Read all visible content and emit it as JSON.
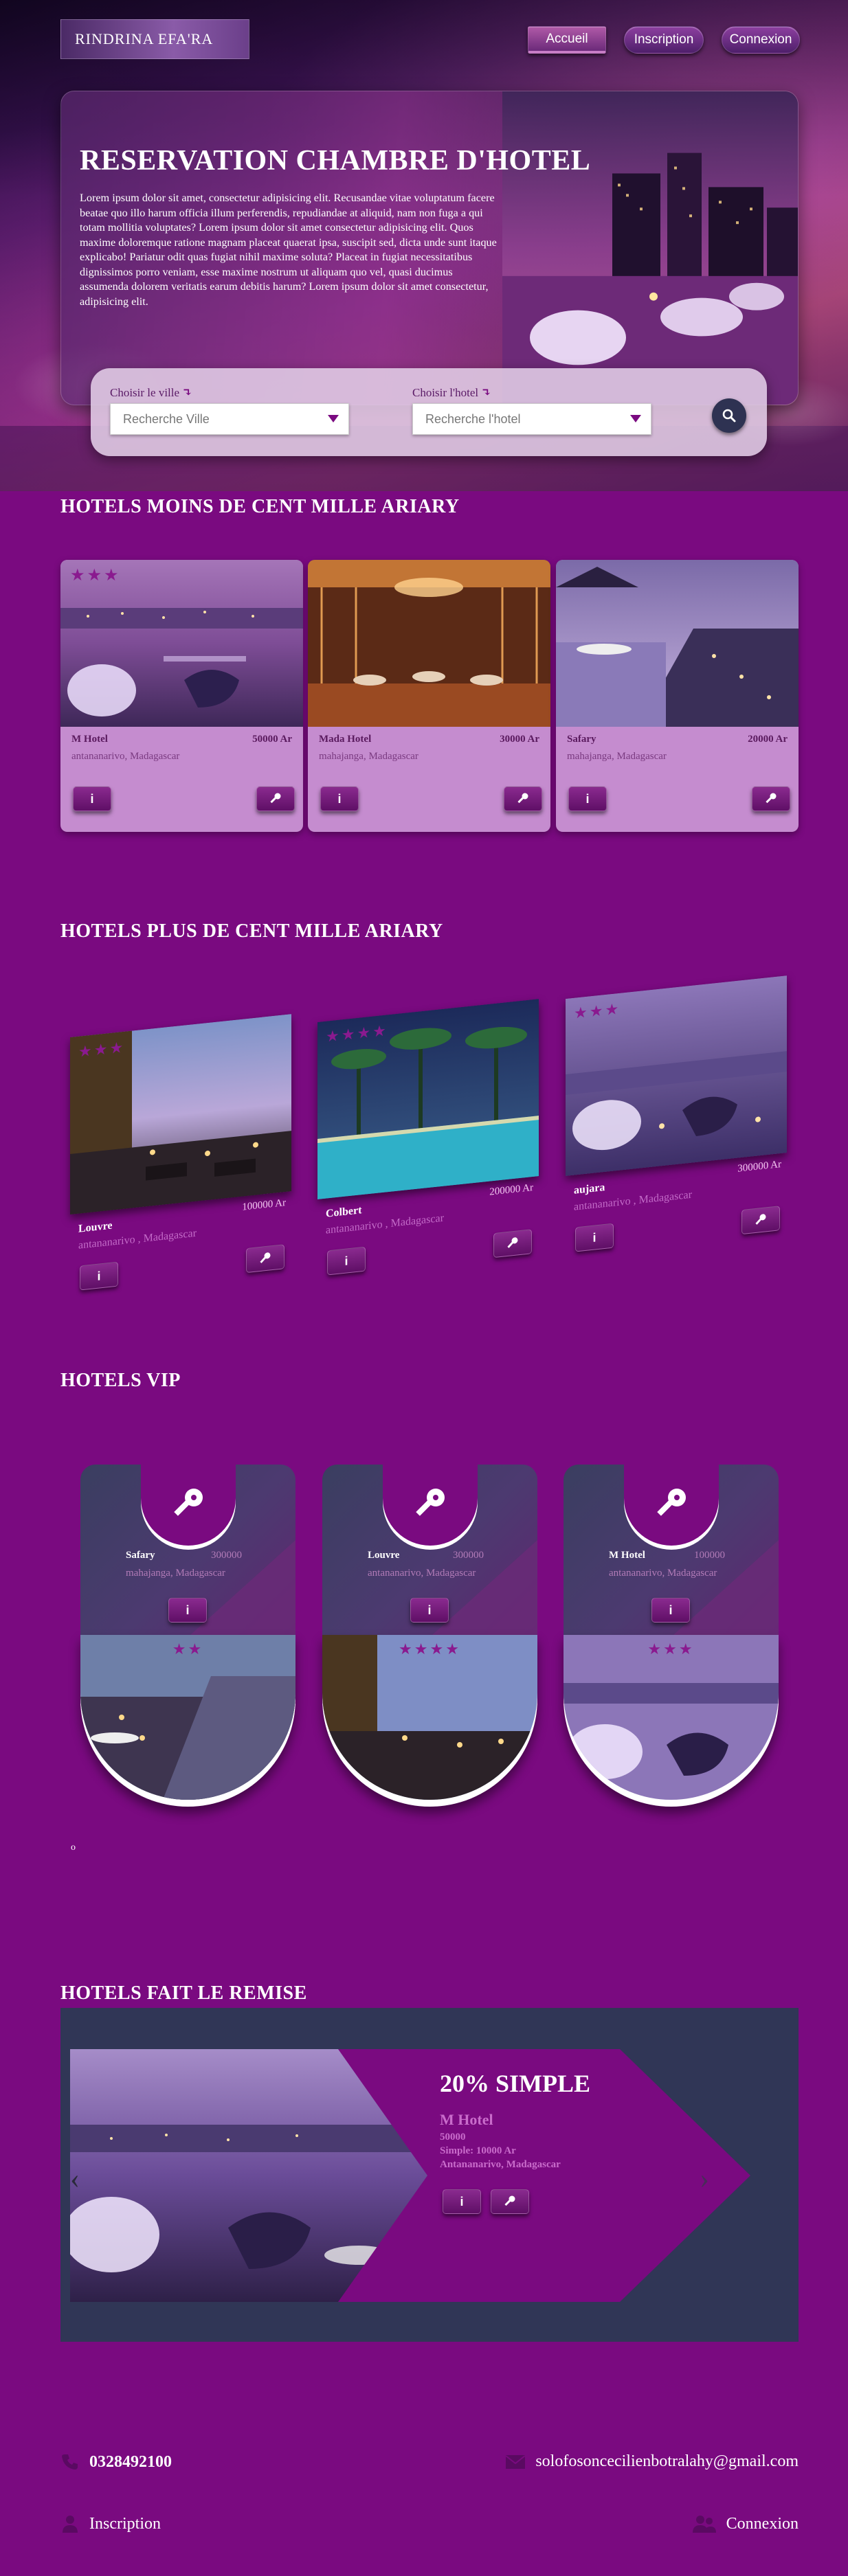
{
  "header": {
    "logo": "RINDRINA EFA'RA",
    "nav": {
      "accueil": "Accueil",
      "inscription": "Inscription",
      "connexion": "Connexion"
    }
  },
  "hero": {
    "title": "RESERVATION CHAMBRE D'HOTEL",
    "text": "Lorem ipsum dolor sit amet, consectetur adipisicing elit. Recusandae vitae voluptatum facere beatae quo illo harum officia illum perferendis, repudiandae at aliquid, nam non fuga a qui totam mollitia voluptates? Lorem ipsum dolor sit amet consectetur adipisicing elit. Quos maxime doloremque ratione magnam placeat quaerat ipsa, suscipit sed, dicta unde sunt itaque explicabo! Pariatur odit quas fugiat nihil maxime soluta? Placeat in fugiat necessitatibus dignissimos porro veniam, esse maxime nostrum ut aliquam quo vel, quasi ducimus assumenda dolorem veritatis earum debitis harum? Lorem ipsum dolor sit amet consectetur, adipisicing elit."
  },
  "search": {
    "city_label": "Choisir le ville",
    "city_placeholder": "Recherche Ville",
    "hotel_label": "Choisir l'hotel",
    "hotel_placeholder": "Recherche l'hotel",
    "label_arrow": "↴"
  },
  "section1": {
    "title": "HOTELS MOINS DE CENT MILLE ARIARY",
    "cards": [
      {
        "stars": "★★★",
        "name": "M Hotel",
        "price": "50000 Ar",
        "location": "antananarivo, Madagascar"
      },
      {
        "stars": "",
        "name": "Mada Hotel",
        "price": "30000 Ar",
        "location": "mahajanga, Madagascar"
      },
      {
        "stars": "",
        "name": "Safary",
        "price": "20000 Ar",
        "location": "mahajanga, Madagascar"
      }
    ]
  },
  "section2": {
    "title": "HOTELS PLUS DE CENT MILLE ARIARY",
    "cards": [
      {
        "stars": "★★★",
        "name": "Louvre",
        "price": "100000 Ar",
        "location": "antananarivo , Madagascar"
      },
      {
        "stars": "★★★★",
        "name": "Colbert",
        "price": "200000 Ar",
        "location": "antananarivo , Madagascar"
      },
      {
        "stars": "★★★",
        "name": "aujara",
        "price": "300000 Ar",
        "location": "antananarivo , Madagascar"
      }
    ]
  },
  "section3": {
    "title": "HOTELS VIP",
    "cards": [
      {
        "stars": "★★",
        "name": "Safary",
        "price": "300000",
        "location": "mahajanga, Madagascar"
      },
      {
        "stars": "★★★★",
        "name": "Louvre",
        "price": "300000",
        "location": "antananarivo, Madagascar"
      },
      {
        "stars": "★★★",
        "name": "M Hotel",
        "price": "100000",
        "location": "antananarivo, Madagascar"
      }
    ],
    "footnote": "o"
  },
  "section4": {
    "title": "HOTELS FAIT LE REMISE",
    "offer": {
      "headline": "20% SIMPLE",
      "name": "M Hotel",
      "price": "50000",
      "simple": "Simple: 10000 Ar",
      "location": "Antananarivo, Madagascar"
    },
    "prev": "‹",
    "next": "›"
  },
  "buttons": {
    "info": "i"
  },
  "footer": {
    "phone": "0328492100",
    "email": "solofosoncecilienbotralahy@gmail.com",
    "inscription": "Inscription",
    "connexion": "Connexion"
  },
  "colors": {
    "page": "#7a0a80",
    "accent": "#8a1a8f",
    "dark_panel": "#303656"
  }
}
